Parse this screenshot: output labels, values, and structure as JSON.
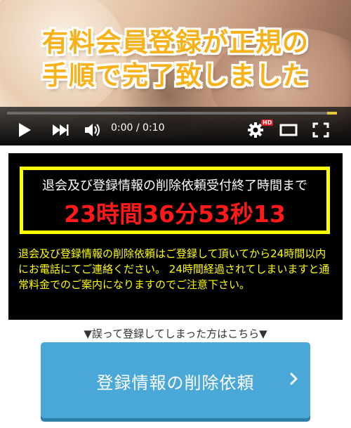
{
  "video": {
    "headline_line1": "有料会員登録が正規の",
    "headline_line2": "手順で完了致しました",
    "time_display": "0:00 / 0:10",
    "hd_badge": "HD",
    "progress_fraction": 0.0,
    "colors": {
      "headline": "#f7b21b",
      "progress_played": "#cc181e",
      "hd_badge": "#e31b23"
    },
    "icons": [
      "play-icon",
      "next-icon",
      "volume-icon",
      "settings-gear-icon",
      "theater-mode-icon",
      "fullscreen-icon"
    ]
  },
  "notice": {
    "timer_label": "退会及び登録情報の削除依頼受付終了時間まで",
    "timer_value": "23時間36分53秒13",
    "message": "退会及び登録情報の削除依頼はご登録して頂いてから24時間以内にお電話にてご連絡ください。 24時間経過されてしまいますと通常料金でのご案内になりますのでご注意下さい。",
    "colors": {
      "border": "#ffff00",
      "timer": "#ff1a1a",
      "message": "#ffff00",
      "background": "#000000"
    }
  },
  "hint": "▼誤って登録してしまった方はこちら▼",
  "delete_button": {
    "label": "登録情報の削除依頼",
    "icon": "chevron-right-icon",
    "color": "#4aa8d8"
  }
}
